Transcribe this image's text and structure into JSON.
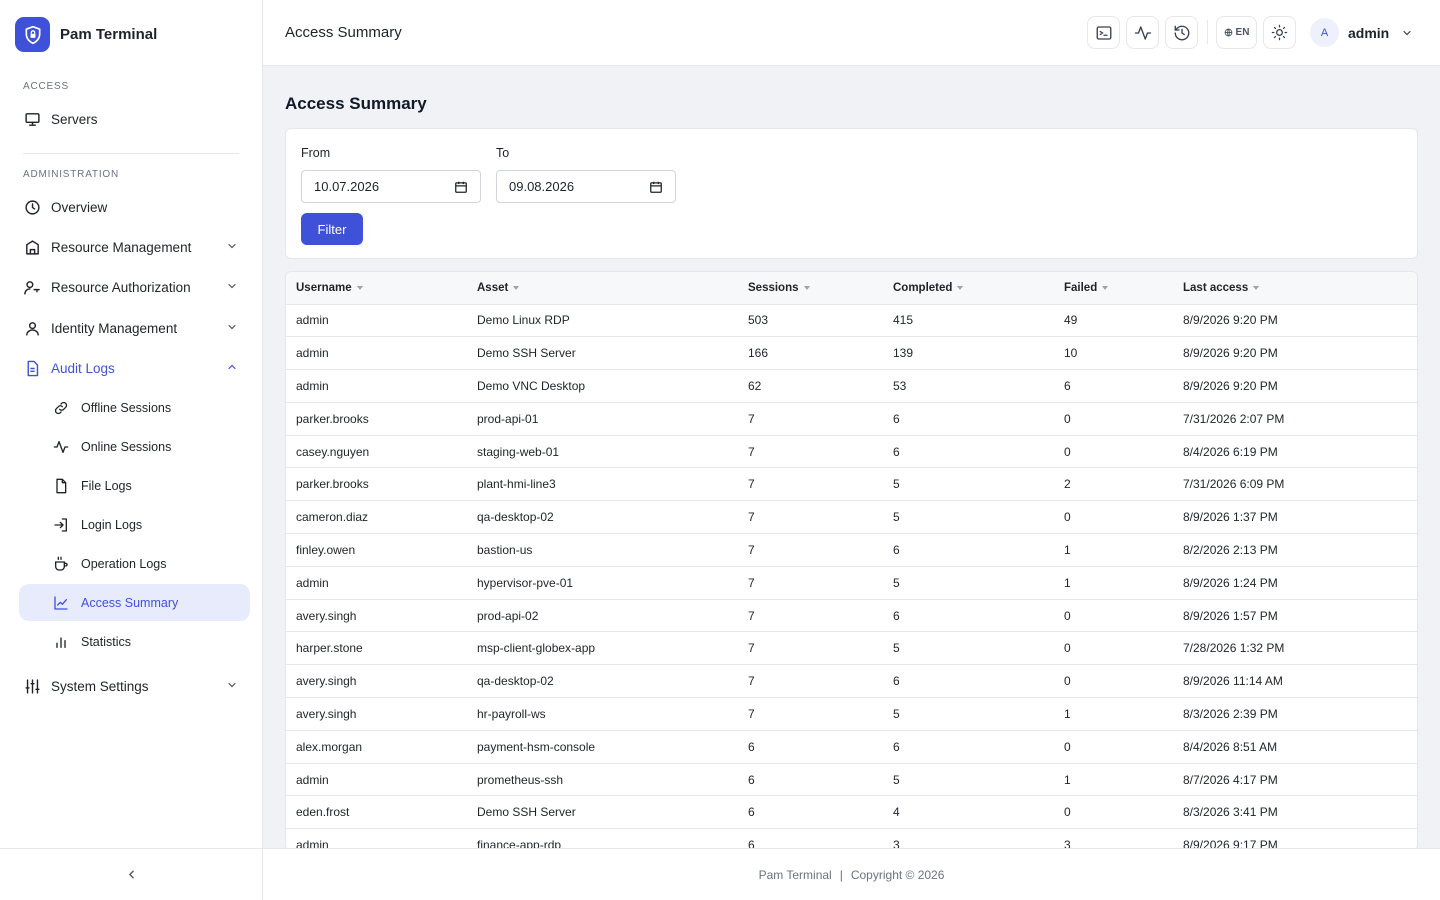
{
  "brand": {
    "name": "Pam Terminal"
  },
  "sidebar": {
    "access_title": "ACCESS",
    "servers": "Servers",
    "admin_title": "ADMINISTRATION",
    "overview": "Overview",
    "resource_management": "Resource Management",
    "resource_authorization": "Resource Authorization",
    "identity_management": "Identity Management",
    "audit_logs": "Audit Logs",
    "audit_children": [
      "Offline Sessions",
      "Online Sessions",
      "File Logs",
      "Login Logs",
      "Operation Logs",
      "Access Summary",
      "Statistics"
    ],
    "system_settings": "System Settings"
  },
  "header": {
    "title": "Access Summary",
    "lang": "EN",
    "avatar_letter": "A",
    "username": "admin"
  },
  "page": {
    "title": "Access Summary"
  },
  "filter": {
    "from_label": "From",
    "from_value": "10.07.2026",
    "to_label": "To",
    "to_value": "09.08.2026",
    "button": "Filter"
  },
  "table": {
    "columns": [
      "Username",
      "Asset",
      "Sessions",
      "Completed",
      "Failed",
      "Last access"
    ],
    "rows": [
      [
        "admin",
        "Demo Linux RDP",
        "503",
        "415",
        "49",
        "8/9/2026 9:20 PM"
      ],
      [
        "admin",
        "Demo SSH Server",
        "166",
        "139",
        "10",
        "8/9/2026 9:20 PM"
      ],
      [
        "admin",
        "Demo VNC Desktop",
        "62",
        "53",
        "6",
        "8/9/2026 9:20 PM"
      ],
      [
        "parker.brooks",
        "prod-api-01",
        "7",
        "6",
        "0",
        "7/31/2026 2:07 PM"
      ],
      [
        "casey.nguyen",
        "staging-web-01",
        "7",
        "6",
        "0",
        "8/4/2026 6:19 PM"
      ],
      [
        "parker.brooks",
        "plant-hmi-line3",
        "7",
        "5",
        "2",
        "7/31/2026 6:09 PM"
      ],
      [
        "cameron.diaz",
        "qa-desktop-02",
        "7",
        "5",
        "0",
        "8/9/2026 1:37 PM"
      ],
      [
        "finley.owen",
        "bastion-us",
        "7",
        "6",
        "1",
        "8/2/2026 2:13 PM"
      ],
      [
        "admin",
        "hypervisor-pve-01",
        "7",
        "5",
        "1",
        "8/9/2026 1:24 PM"
      ],
      [
        "avery.singh",
        "prod-api-02",
        "7",
        "6",
        "0",
        "8/9/2026 1:57 PM"
      ],
      [
        "harper.stone",
        "msp-client-globex-app",
        "7",
        "5",
        "0",
        "7/28/2026 1:32 PM"
      ],
      [
        "avery.singh",
        "qa-desktop-02",
        "7",
        "6",
        "0",
        "8/9/2026 11:14 AM"
      ],
      [
        "avery.singh",
        "hr-payroll-ws",
        "7",
        "5",
        "1",
        "8/3/2026 2:39 PM"
      ],
      [
        "alex.morgan",
        "payment-hsm-console",
        "6",
        "6",
        "0",
        "8/4/2026 8:51 AM"
      ],
      [
        "admin",
        "prometheus-ssh",
        "6",
        "5",
        "1",
        "8/7/2026 4:17 PM"
      ],
      [
        "eden.frost",
        "Demo SSH Server",
        "6",
        "4",
        "0",
        "8/3/2026 3:41 PM"
      ],
      [
        "admin",
        "finance-app-rdp",
        "6",
        "3",
        "3",
        "8/9/2026 9:17 PM"
      ]
    ]
  },
  "footer": {
    "brand": "Pam Terminal",
    "separator": "|",
    "copyright": "Copyright © 2026"
  },
  "colors": {
    "accent": "#3f51d8",
    "accent_soft": "#e8ebfb",
    "page_bg": "#f0f2f5",
    "border": "#e5e7eb"
  }
}
